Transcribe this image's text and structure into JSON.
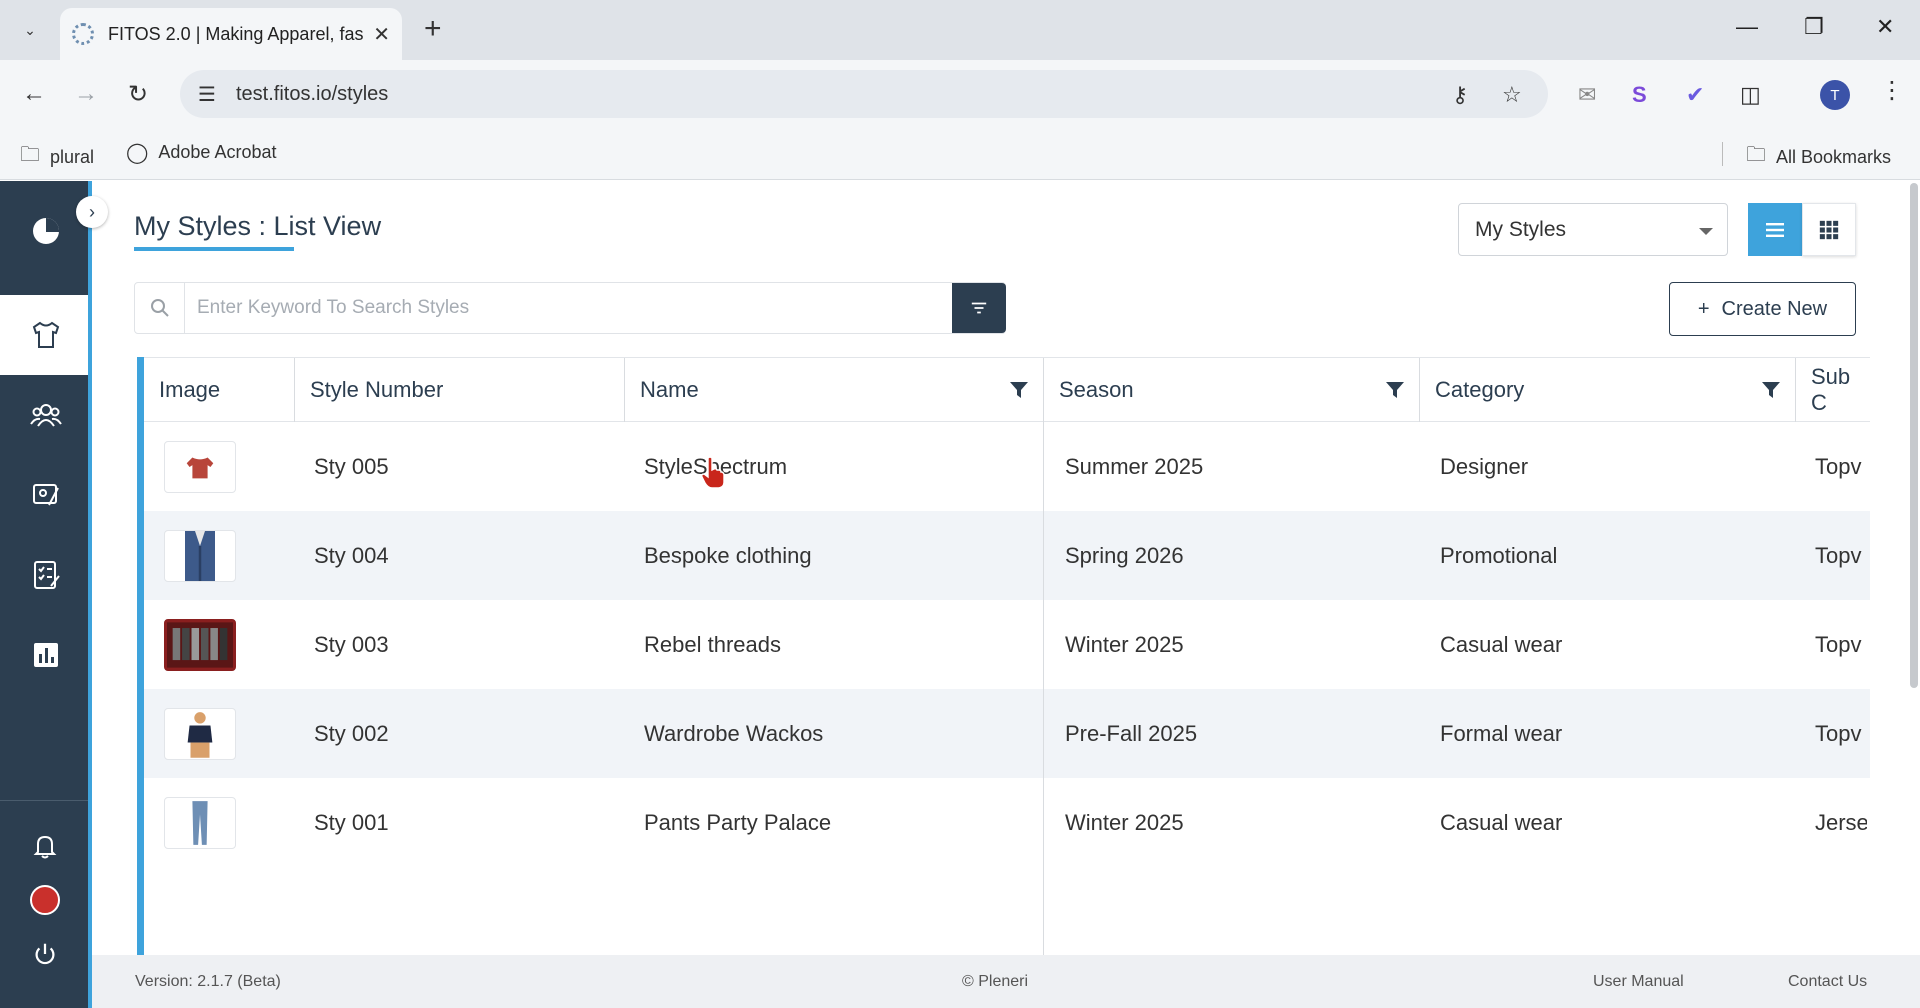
{
  "browser": {
    "tab_title": "FITOS 2.0 | Making Apparel, fas",
    "url": "test.fitos.io/styles",
    "bookmarks": [
      {
        "label": "plural",
        "icon": "folder-icon"
      },
      {
        "label": "Adobe Acrobat",
        "icon": "globe-icon"
      }
    ],
    "all_bookmarks": "All Bookmarks",
    "profile_initial": "T"
  },
  "sidebar": {
    "items": [
      {
        "name": "dashboard",
        "icon": "pie-chart-icon"
      },
      {
        "name": "styles",
        "icon": "garment-icon",
        "active": true
      },
      {
        "name": "team",
        "icon": "people-icon"
      },
      {
        "name": "design",
        "icon": "designer-icon"
      },
      {
        "name": "tasks",
        "icon": "checklist-icon"
      },
      {
        "name": "reports",
        "icon": "bar-chart-icon"
      }
    ],
    "bottom": [
      "bell-icon",
      "avatar",
      "power-icon"
    ]
  },
  "header": {
    "title": "My Styles : List View",
    "select_value": "My Styles"
  },
  "search": {
    "placeholder": "Enter Keyword To Search Styles"
  },
  "create_label": "Create New",
  "table": {
    "columns": [
      "Image",
      "Style Number",
      "Name",
      "Season",
      "Category",
      "Sub C"
    ],
    "rows": [
      {
        "style_number": "Sty 005",
        "name": "StyleSpectrum",
        "season": "Summer 2025",
        "category": "Designer",
        "sub_category": "Topv",
        "thumb_color": "#b8453a"
      },
      {
        "style_number": "Sty 004",
        "name": "Bespoke clothing",
        "season": "Spring 2026",
        "category": "Promotional",
        "sub_category": "Topv",
        "thumb_color": "#3d5a8a"
      },
      {
        "style_number": "Sty 003",
        "name": "Rebel threads",
        "season": "Winter 2025",
        "category": "Casual wear",
        "sub_category": "Topv",
        "thumb_color": "#8a1f1f"
      },
      {
        "style_number": "Sty 002",
        "name": "Wardrobe Wackos",
        "season": "Pre-Fall 2025",
        "category": "Formal wear",
        "sub_category": "Topv",
        "thumb_color": "#1f2a44"
      },
      {
        "style_number": "Sty 001",
        "name": "Pants Party Palace",
        "season": "Winter 2025",
        "category": "Casual wear",
        "sub_category": "Jerse",
        "thumb_color": "#6e8fb5"
      }
    ]
  },
  "footer": {
    "version": "Version: 2.1.7 (Beta)",
    "copyright": "© Pleneri",
    "user_manual": "User Manual",
    "contact": "Contact Us"
  },
  "colors": {
    "sidebar": "#2c3e50",
    "accent": "#3ea3dc",
    "row_alt": "#f1f4f8"
  }
}
